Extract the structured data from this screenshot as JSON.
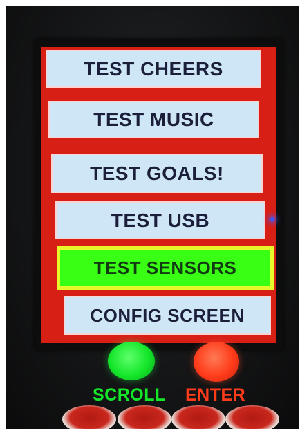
{
  "menu": {
    "items": [
      {
        "label": "TEST CHEERS",
        "active": false
      },
      {
        "label": "TEST MUSIC",
        "active": false
      },
      {
        "label": "TEST GOALS!",
        "active": false
      },
      {
        "label": "TEST USB",
        "active": false
      },
      {
        "label": "TEST SENSORS",
        "active": true
      },
      {
        "label": "CONFIG SCREEN",
        "active": false
      }
    ]
  },
  "controls": {
    "scroll": {
      "label": "SCROLL",
      "color": "#14e62a"
    },
    "enter": {
      "label": "ENTER",
      "color": "#ff3b1a"
    }
  },
  "colors": {
    "screen_bg": "#d81f16",
    "button_bg": "#cfe6f7",
    "button_text": "#1b1f3a",
    "active_bg": "#39ff14",
    "active_border": "#e6f72a"
  }
}
